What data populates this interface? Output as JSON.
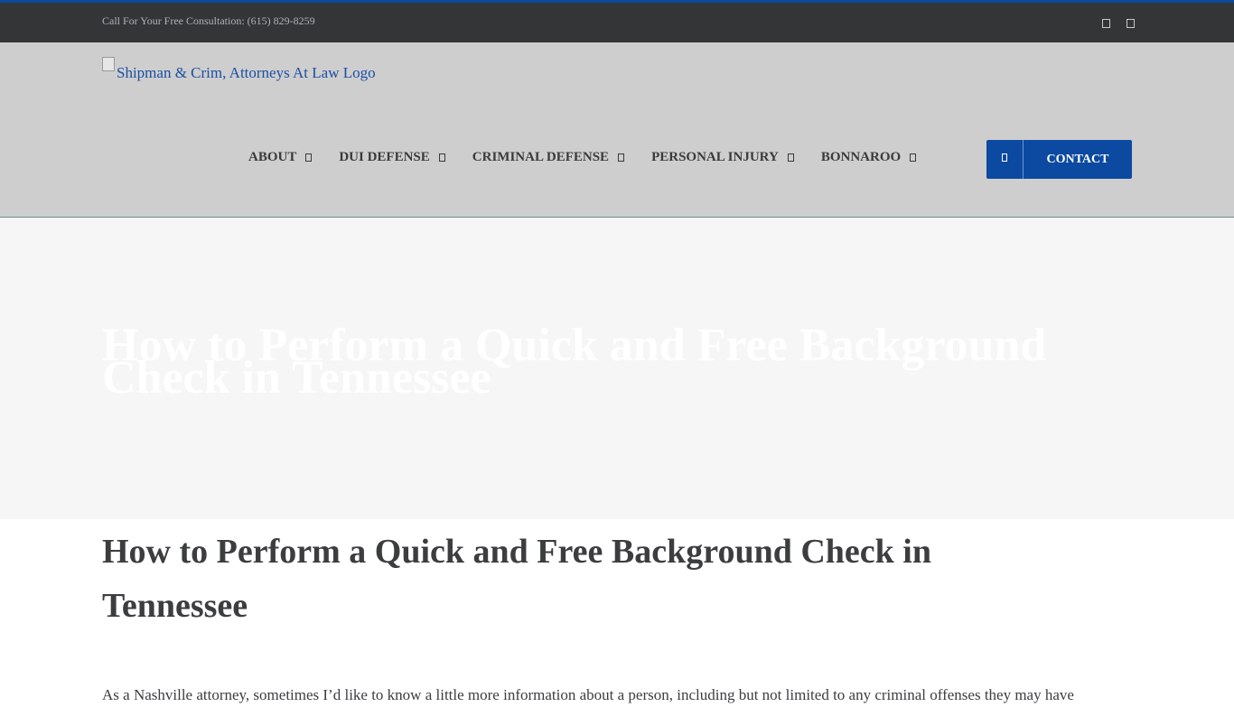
{
  "topbar": {
    "phone": "Call For Your Free Consultation: (615) 829-8259",
    "social_icons": [
      "facebook-icon",
      "twitter-icon"
    ]
  },
  "header": {
    "logo_alt": "Shipman & Crim, Attorneys At Law Logo",
    "nav": [
      {
        "label": "ABOUT"
      },
      {
        "label": "DUI DEFENSE"
      },
      {
        "label": "CRIMINAL DEFENSE"
      },
      {
        "label": "PERSONAL INJURY"
      },
      {
        "label": "BONNAROO"
      }
    ],
    "contact_label": "CONTACT"
  },
  "hero": {
    "title": "How to Perform a Quick and Free Background Check in Tennessee"
  },
  "post": {
    "title": "How to Perform a Quick and Free Background Check in Tennessee",
    "body": "As a Nashville attorney, sometimes I’d like to know a little more information about a person, including but not limited to any criminal offenses they may have"
  },
  "colors": {
    "accent": "#0b4aa0",
    "topbar_bg": "#333537",
    "header_bg": "#cecece",
    "hero_bg": "#f6f6f6"
  }
}
